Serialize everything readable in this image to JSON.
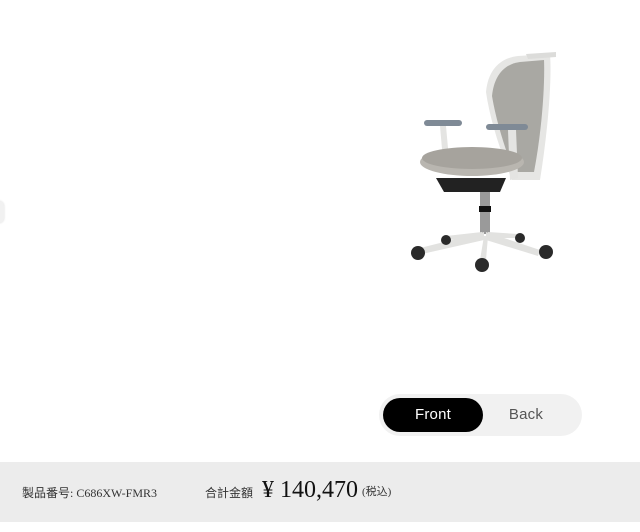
{
  "toggle": {
    "front_label": "Front",
    "back_label": "Back",
    "selected": "Front"
  },
  "footer": {
    "product_code_label": "製品番号: C686XW-FMR3",
    "total_label": "合計金額",
    "price": "¥ 140,470",
    "tax_note": "(税込)"
  },
  "colors": {
    "toggle_active_bg": "#000000",
    "toggle_track_bg": "#f1f1f1",
    "footer_bg": "#ececec"
  }
}
